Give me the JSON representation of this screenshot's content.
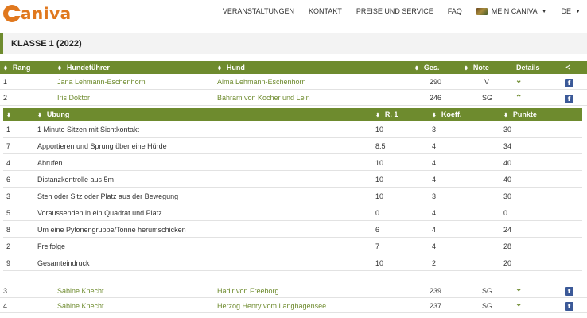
{
  "brand": {
    "logo_text": "aniva",
    "logo_alt": "Caniva"
  },
  "nav": {
    "items": [
      "VERANSTALTUNGEN",
      "KONTAKT",
      "PREISE UND SERVICE",
      "FAQ"
    ],
    "account": "MEIN CANIVA",
    "language": "DE"
  },
  "section": {
    "title": "KLASSE 1 (2022)"
  },
  "main_table": {
    "headers": {
      "rank": "Rang",
      "handler": "Hundeführer",
      "dog": "Hund",
      "total": "Ges.",
      "grade": "Note",
      "details": "Details"
    },
    "rows": [
      {
        "rank": "1",
        "handler": "Jana Lehmann-Eschenhorn",
        "dog": "Alma Lehmann-Eschenhorn",
        "total": "290",
        "grade": "V",
        "expanded": false
      },
      {
        "rank": "2",
        "handler": "Iris Doktor",
        "dog": "Bahram von Kocher und Lein",
        "total": "246",
        "grade": "SG",
        "expanded": true
      },
      {
        "rank": "3",
        "handler": "Sabine Knecht",
        "dog": "Hadir von Freeborg",
        "total": "239",
        "grade": "SG",
        "expanded": false
      },
      {
        "rank": "4",
        "handler": "Sabine Knecht",
        "dog": "Herzog Henry vom Langhagensee",
        "total": "237",
        "grade": "SG",
        "expanded": false
      }
    ]
  },
  "detail_table": {
    "headers": {
      "exercise": "Übung",
      "r1": "R. 1",
      "coeff": "Koeff.",
      "points": "Punkte"
    },
    "rows": [
      {
        "nr": "1",
        "exercise": "1 Minute Sitzen mit Sichtkontakt",
        "r1": "10",
        "coeff": "3",
        "points": "30"
      },
      {
        "nr": "7",
        "exercise": "Apportieren und Sprung über eine Hürde",
        "r1": "8.5",
        "coeff": "4",
        "points": "34"
      },
      {
        "nr": "4",
        "exercise": "Abrufen",
        "r1": "10",
        "coeff": "4",
        "points": "40"
      },
      {
        "nr": "6",
        "exercise": "Distanzkontrolle aus 5m",
        "r1": "10",
        "coeff": "4",
        "points": "40"
      },
      {
        "nr": "3",
        "exercise": "Steh oder Sitz oder Platz aus der Bewegung",
        "r1": "10",
        "coeff": "3",
        "points": "30"
      },
      {
        "nr": "5",
        "exercise": "Voraussenden in ein Quadrat und Platz",
        "r1": "0",
        "coeff": "4",
        "points": "0"
      },
      {
        "nr": "8",
        "exercise": "Um eine Pylonengruppe/Tonne herumschicken",
        "r1": "6",
        "coeff": "4",
        "points": "24"
      },
      {
        "nr": "2",
        "exercise": "Freifolge",
        "r1": "7",
        "coeff": "4",
        "points": "28"
      },
      {
        "nr": "9",
        "exercise": "Gesamteindruck",
        "r1": "10",
        "coeff": "2",
        "points": "20"
      }
    ]
  },
  "icons": {
    "sort": "sort-icon",
    "chevron_down": "chevron-down-icon",
    "chevron_up": "chevron-up-icon",
    "facebook": "facebook-icon",
    "share": "share-icon",
    "caret": "caret-down-icon",
    "flag": "flag-icon"
  },
  "colors": {
    "accent": "#6e8b2e",
    "brand": "#e0781e",
    "facebook": "#3b5998"
  }
}
